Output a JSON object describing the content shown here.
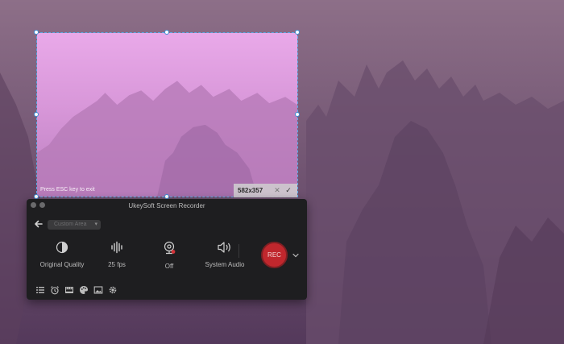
{
  "selection": {
    "esc_hint": "Press ESC key to exit",
    "size_label": "582x357",
    "cancel_glyph": "✕",
    "confirm_glyph": "✓"
  },
  "recorder": {
    "title": "UkeySoft Screen Recorder",
    "mode_select": "Custom Area",
    "controls": {
      "quality": "Original Quality",
      "fps": "25 fps",
      "camera": "Off",
      "audio": "System Audio"
    },
    "rec_label": "REC"
  },
  "icons": {
    "back": "arrow-left-icon",
    "quality": "half-circle-icon",
    "fps": "sound-wave-icon",
    "camera": "webcam-off-icon",
    "audio": "speaker-icon",
    "rec_dropdown": "chevron-down-icon",
    "tools": [
      "list-icon",
      "alarm-clock-icon",
      "film-icon",
      "palette-icon",
      "image-icon",
      "gear-icon"
    ]
  },
  "colors": {
    "selection_border": "#5aa9e6",
    "rec": "#c0272d",
    "recorder_bg": "#1e1e20"
  }
}
